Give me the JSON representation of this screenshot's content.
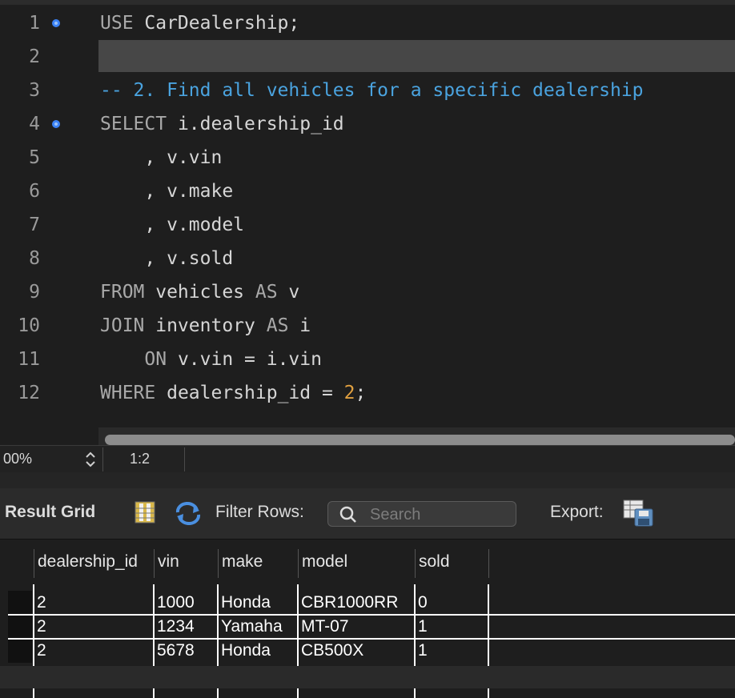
{
  "editor": {
    "lines": [
      {
        "n": "1",
        "marker": true,
        "tokens": [
          [
            "kw",
            "USE"
          ],
          [
            "t",
            " CarDealership;"
          ]
        ]
      },
      {
        "n": "2",
        "marker": false,
        "tokens": []
      },
      {
        "n": "3",
        "marker": false,
        "tokens": [
          [
            "cm",
            "-- 2. Find all vehicles for a specific dealership"
          ]
        ]
      },
      {
        "n": "4",
        "marker": true,
        "tokens": [
          [
            "kw",
            "SELECT"
          ],
          [
            "t",
            " i.dealership_id"
          ]
        ]
      },
      {
        "n": "5",
        "marker": false,
        "tokens": [
          [
            "t",
            "    , v.vin"
          ]
        ]
      },
      {
        "n": "6",
        "marker": false,
        "tokens": [
          [
            "t",
            "    , v.make"
          ]
        ]
      },
      {
        "n": "7",
        "marker": false,
        "tokens": [
          [
            "t",
            "    , v.model"
          ]
        ]
      },
      {
        "n": "8",
        "marker": false,
        "tokens": [
          [
            "t",
            "    , v.sold"
          ]
        ]
      },
      {
        "n": "9",
        "marker": false,
        "tokens": [
          [
            "kw",
            "FROM"
          ],
          [
            "t",
            " vehicles "
          ],
          [
            "kw",
            "AS"
          ],
          [
            "t",
            " v"
          ]
        ]
      },
      {
        "n": "10",
        "marker": false,
        "tokens": [
          [
            "kw",
            "JOIN"
          ],
          [
            "t",
            " inventory "
          ],
          [
            "kw",
            "AS"
          ],
          [
            "t",
            " i"
          ]
        ]
      },
      {
        "n": "11",
        "marker": false,
        "tokens": [
          [
            "t",
            "    "
          ],
          [
            "kw",
            "ON"
          ],
          [
            "t",
            " v.vin = i.vin"
          ]
        ]
      },
      {
        "n": "12",
        "marker": false,
        "tokens": [
          [
            "kw",
            "WHERE"
          ],
          [
            "t",
            " dealership_id = "
          ],
          [
            "num",
            "2"
          ],
          [
            "t",
            ";"
          ]
        ]
      }
    ]
  },
  "status": {
    "zoom": "00%",
    "position": "1:2"
  },
  "toolbar": {
    "title": "Result Grid",
    "filter_label": "Filter Rows:",
    "search_placeholder": "Search",
    "export_label": "Export:"
  },
  "grid": {
    "columns": [
      "dealership_id",
      "vin",
      "make",
      "model",
      "sold"
    ],
    "rows": [
      [
        "2",
        "1000",
        "Honda",
        "CBR1000RR",
        "0"
      ],
      [
        "2",
        "1234",
        "Yamaha",
        "MT-07",
        "1"
      ],
      [
        "2",
        "5678",
        "Honda",
        "CB500X",
        "1"
      ]
    ]
  },
  "colors": {
    "keyword": "#a9a9a9",
    "comment": "#4aa3df",
    "number": "#e0a040",
    "marker": "#3b82f6"
  }
}
